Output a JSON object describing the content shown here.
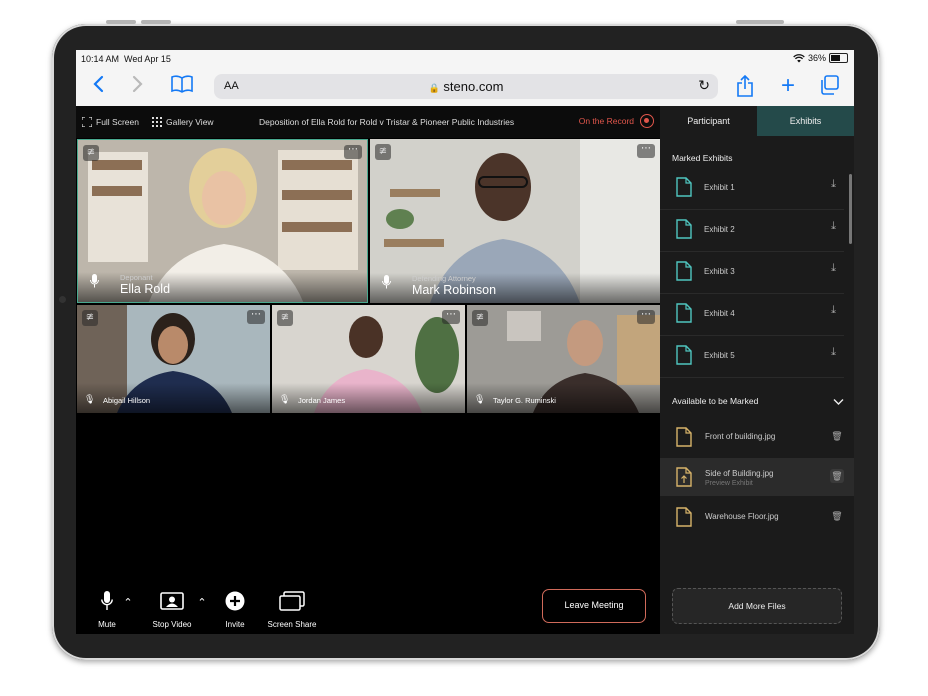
{
  "status": {
    "time": "10:14 AM",
    "date": "Wed Apr 15",
    "battery": "36%"
  },
  "browser": {
    "text_size": "AA",
    "url": "steno.com"
  },
  "toolbar": {
    "full_screen": "Full Screen",
    "gallery_view": "Gallery View",
    "title": "Deposition of Ella Rold for Rold v Tristar & Pioneer Public Industries",
    "record_status": "On the Record"
  },
  "participants": [
    {
      "role": "Deponant",
      "name": "Ella Rold"
    },
    {
      "role": "Defending Attorney",
      "name": "Mark Robinson"
    },
    {
      "role": "",
      "name": "Abigail Hillson"
    },
    {
      "role": "",
      "name": "Jordan James"
    },
    {
      "role": "",
      "name": "Taylor G. Ruminski"
    }
  ],
  "controls": {
    "mute": "Mute",
    "stop_video": "Stop Video",
    "invite": "Invite",
    "screen_share": "Screen Share",
    "leave": "Leave Meeting"
  },
  "panel": {
    "tabs": [
      "Participant",
      "Exhibits"
    ],
    "active_tab": "Exhibits",
    "marked_title": "Marked Exhibits",
    "exhibits": [
      "Exhibit 1",
      "Exhibit 2",
      "Exhibit 3",
      "Exhibit 4",
      "Exhibit 5"
    ],
    "available_title": "Available to be Marked",
    "files": [
      {
        "name": "Front of building.jpg",
        "sub": ""
      },
      {
        "name": "Side of Building.jpg",
        "sub": "Preview Exhibit"
      },
      {
        "name": "Warehouse Floor.jpg",
        "sub": ""
      }
    ],
    "add_more": "Add More Files"
  },
  "colors": {
    "accent_teal": "#4fc6c0",
    "record_red": "#e0564b",
    "file_gold": "#d7b36a",
    "active_tab": "#244a4a"
  }
}
